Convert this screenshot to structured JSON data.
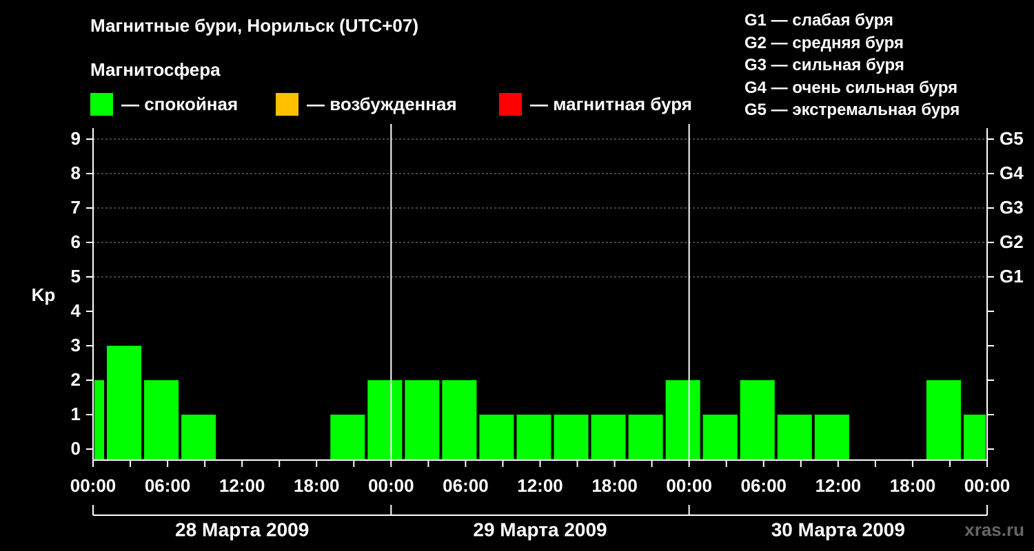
{
  "header": {
    "title": "Магнитные бури, Норильск (UTC+07)",
    "magnetosphere_label": "Магнитосфера"
  },
  "legend": [
    {
      "color": "#00ff00",
      "label": "— спокойная"
    },
    {
      "color": "#ffc000",
      "label": "— возбужденная"
    },
    {
      "color": "#ff0000",
      "label": "— магнитная буря"
    }
  ],
  "storm_scale": [
    "G1 — слабая буря",
    "G2 — средняя буря",
    "G3 — сильная буря",
    "G4 — очень сильная буря",
    "G5 — экстремальная буря"
  ],
  "credit": "xras.ru",
  "chart_data": {
    "type": "bar",
    "ylabel": "Kp",
    "ylim": [
      0,
      9
    ],
    "yticks": [
      0,
      1,
      2,
      3,
      4,
      5,
      6,
      7,
      8,
      9
    ],
    "right_axis_labels": [
      {
        "kp": 5,
        "label": "G1"
      },
      {
        "kp": 6,
        "label": "G2"
      },
      {
        "kp": 7,
        "label": "G3"
      },
      {
        "kp": 8,
        "label": "G4"
      },
      {
        "kp": 9,
        "label": "G5"
      }
    ],
    "xlim_hours": [
      0,
      72
    ],
    "x_tick_labels": [
      "00:00",
      "06:00",
      "12:00",
      "18:00",
      "00:00",
      "06:00",
      "12:00",
      "18:00",
      "00:00",
      "06:00",
      "12:00",
      "18:00",
      "00:00"
    ],
    "days": [
      "28 Марта 2009",
      "29 Марта 2009",
      "30 Марта 2009"
    ],
    "grid": "horizontal dashed at Kp 5–9",
    "bar_color": "#00ff00",
    "bars": [
      {
        "start": "28 Марта 2009 00:00",
        "end": "28 Марта 2009 01:00",
        "kp": 2
      },
      {
        "start": "28 Марта 2009 01:00",
        "end": "28 Марта 2009 04:00",
        "kp": 3
      },
      {
        "start": "28 Марта 2009 04:00",
        "end": "28 Марта 2009 07:00",
        "kp": 2
      },
      {
        "start": "28 Марта 2009 07:00",
        "end": "28 Марта 2009 10:00",
        "kp": 1
      },
      {
        "start": "28 Марта 2009 10:00",
        "end": "28 Марта 2009 13:00",
        "kp": 0
      },
      {
        "start": "28 Марта 2009 13:00",
        "end": "28 Марта 2009 16:00",
        "kp": 0
      },
      {
        "start": "28 Марта 2009 16:00",
        "end": "28 Марта 2009 19:00",
        "kp": 0
      },
      {
        "start": "28 Марта 2009 19:00",
        "end": "28 Марта 2009 22:00",
        "kp": 1
      },
      {
        "start": "28 Марта 2009 22:00",
        "end": "29 Марта 2009 01:00",
        "kp": 2
      },
      {
        "start": "29 Марта 2009 01:00",
        "end": "29 Марта 2009 04:00",
        "kp": 2
      },
      {
        "start": "29 Марта 2009 04:00",
        "end": "29 Марта 2009 07:00",
        "kp": 2
      },
      {
        "start": "29 Марта 2009 07:00",
        "end": "29 Марта 2009 10:00",
        "kp": 1
      },
      {
        "start": "29 Марта 2009 10:00",
        "end": "29 Марта 2009 13:00",
        "kp": 1
      },
      {
        "start": "29 Марта 2009 13:00",
        "end": "29 Марта 2009 16:00",
        "kp": 1
      },
      {
        "start": "29 Марта 2009 16:00",
        "end": "29 Марта 2009 19:00",
        "kp": 1
      },
      {
        "start": "29 Марта 2009 19:00",
        "end": "29 Марта 2009 22:00",
        "kp": 1
      },
      {
        "start": "29 Марта 2009 22:00",
        "end": "30 Марта 2009 01:00",
        "kp": 2
      },
      {
        "start": "30 Марта 2009 01:00",
        "end": "30 Марта 2009 04:00",
        "kp": 1
      },
      {
        "start": "30 Марта 2009 04:00",
        "end": "30 Марта 2009 07:00",
        "kp": 2
      },
      {
        "start": "30 Марта 2009 07:00",
        "end": "30 Марта 2009 10:00",
        "kp": 1
      },
      {
        "start": "30 Марта 2009 10:00",
        "end": "30 Марта 2009 13:00",
        "kp": 1
      },
      {
        "start": "30 Марта 2009 13:00",
        "end": "30 Марта 2009 16:00",
        "kp": 0
      },
      {
        "start": "30 Марта 2009 16:00",
        "end": "30 Марта 2009 19:00",
        "kp": 0
      },
      {
        "start": "30 Марта 2009 19:00",
        "end": "30 Марта 2009 22:00",
        "kp": 2
      },
      {
        "start": "30 Марта 2009 22:00",
        "end": "31 Марта 2009 00:00",
        "kp": 1
      }
    ]
  }
}
